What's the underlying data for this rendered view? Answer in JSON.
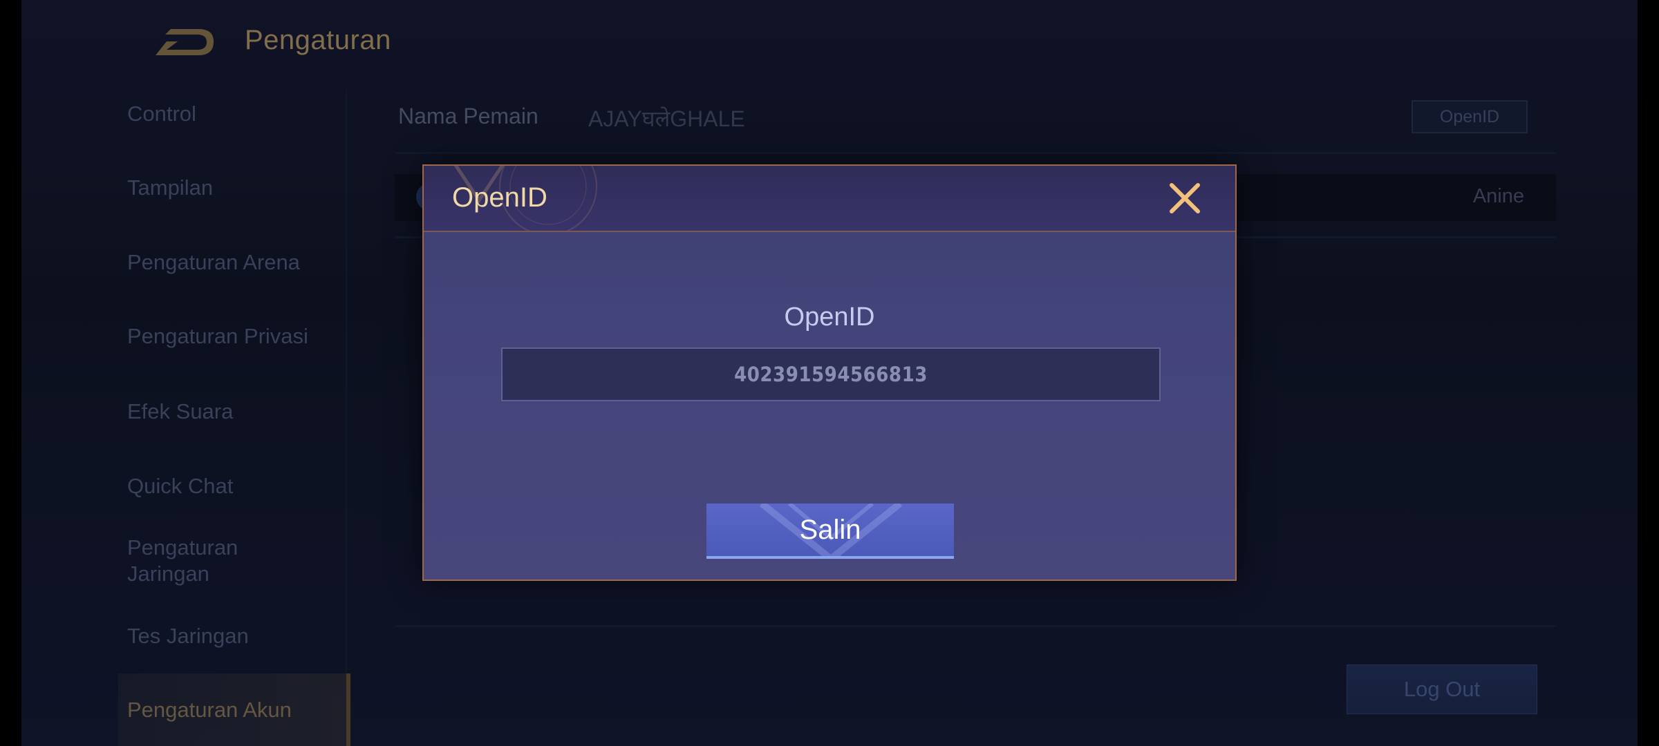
{
  "header": {
    "title": "Pengaturan"
  },
  "sidebar": {
    "items": [
      {
        "label": "Control"
      },
      {
        "label": "Tampilan"
      },
      {
        "label": "Pengaturan Arena"
      },
      {
        "label": "Pengaturan Privasi"
      },
      {
        "label": "Efek Suara"
      },
      {
        "label": "Quick Chat"
      },
      {
        "label": "Pengaturan Jaringan"
      },
      {
        "label": "Tes Jaringan"
      },
      {
        "label": "Pengaturan Akun"
      }
    ],
    "active_index": 8
  },
  "content": {
    "player_label": "Nama Pemain",
    "player_name": "AJAYघलेGHALE",
    "openid_button": "OpenID",
    "row_value": "Anine",
    "logout_button": "Log Out"
  },
  "modal": {
    "title": "OpenID",
    "field_label": "OpenID",
    "openid_value": "402391594566813",
    "copy_button": "Salin"
  },
  "colors": {
    "accent_gold": "#f0d9a6",
    "modal_bg": "#43447a",
    "button_blue": "#5a67c8"
  }
}
